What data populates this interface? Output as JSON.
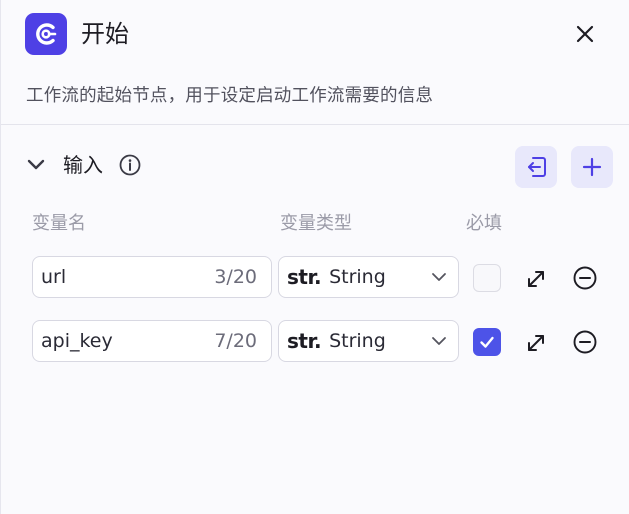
{
  "header": {
    "title": "开始",
    "description": "工作流的起始节点，用于设定启动工作流需要的信息",
    "icon": "start-node-icon",
    "accent": "#4e40e5"
  },
  "inputs": {
    "title": "输入",
    "columns": {
      "name": "变量名",
      "type": "变量类型",
      "required": "必填"
    },
    "rows": [
      {
        "name": "url",
        "count": "3/20",
        "type_prefix": "str.",
        "type": "String",
        "required": false
      },
      {
        "name": "api_key",
        "count": "7/20",
        "type_prefix": "str.",
        "type": "String",
        "required": true
      }
    ]
  },
  "colors": {
    "checkbox_checked": "#4d53e8",
    "button_bg": "#e8e8fb"
  }
}
